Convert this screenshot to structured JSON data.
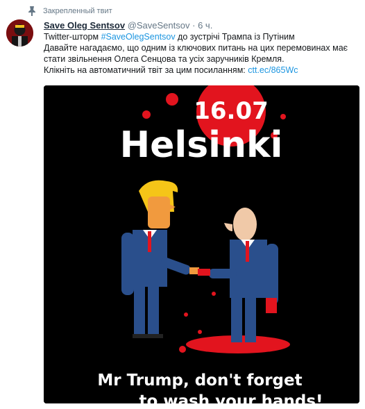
{
  "pinned_label": "Закрепленный твит",
  "author": {
    "name": "Save Oleg Sentsov",
    "handle": "@SaveSentsov",
    "separator": "·",
    "time": "6 ч."
  },
  "tweet": {
    "line1_pre": "Twitter-шторм ",
    "hashtag": "#SaveOlegSentsov",
    "line1_post": " до зустрічі Трампа із Путіним",
    "line2": "Давайте нагадаємо, що одним із ключових питань на цих перемовинах має",
    "line3": "стати звільнення Олега Сенцова та усіх заручників Кремля.",
    "line4_pre": "Клікніть на автоматичний твіт за цим посиланням: ",
    "link": "ctt.ec/865Wc"
  },
  "poster": {
    "date": "16.07",
    "city": "Helsinki",
    "caption_line1": "Mr Trump, don't forget",
    "caption_line2": "to wash your hands!"
  },
  "colors": {
    "link": "#1b95e0",
    "accent_red": "#e2141e",
    "suit": "#2a4f8c",
    "hair": "#f5c518",
    "skin": "#f19a3e"
  }
}
